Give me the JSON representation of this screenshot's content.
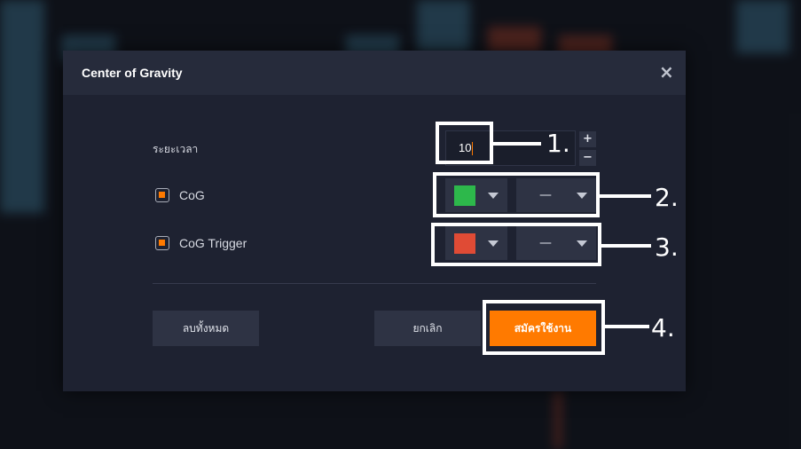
{
  "dialog": {
    "title": "Center of Gravity",
    "close_label": "×"
  },
  "period": {
    "label": "ระยะเวลา",
    "value": "10",
    "increment_label": "+",
    "decrement_label": "−"
  },
  "series": [
    {
      "label": "CoG",
      "checked": true,
      "color": "#2db84b",
      "line_style": "—"
    },
    {
      "label": "CoG Trigger",
      "checked": true,
      "color": "#e04b35",
      "line_style": "—"
    }
  ],
  "buttons": {
    "clear_label": "ลบทั้งหมด",
    "cancel_label": "ยกเลิก",
    "apply_label": "สมัครใช้งาน"
  },
  "annotations": [
    "1.",
    "2.",
    "3.",
    "4."
  ],
  "colors": {
    "accent": "#ff7a00",
    "dialog_bg": "#1e2231",
    "header_bg": "#262b3b",
    "control_bg": "#2e3344"
  }
}
